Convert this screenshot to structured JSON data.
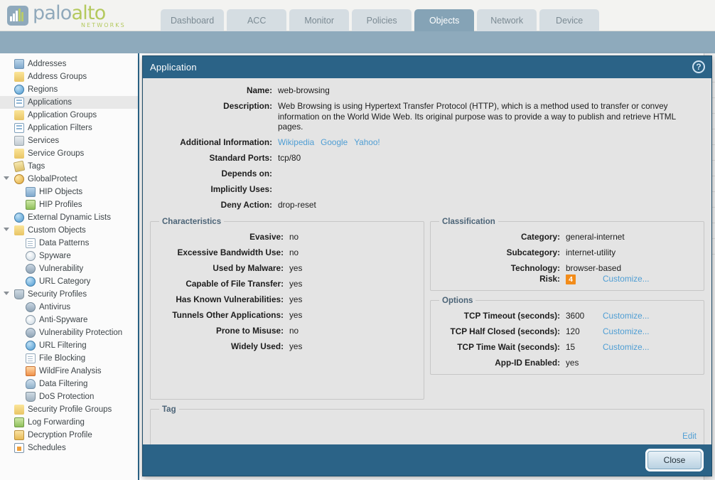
{
  "brand": {
    "name_part1": "palo",
    "name_part2": "alto",
    "tagline": "NETWORKS"
  },
  "nav_tabs": [
    {
      "label": "Dashboard",
      "active": false
    },
    {
      "label": "ACC",
      "active": false
    },
    {
      "label": "Monitor",
      "active": false
    },
    {
      "label": "Policies",
      "active": false
    },
    {
      "label": "Objects",
      "active": true
    },
    {
      "label": "Network",
      "active": false
    },
    {
      "label": "Device",
      "active": false
    }
  ],
  "sidebar": {
    "items": [
      {
        "label": "Addresses",
        "level": 0,
        "icon": "addresses-icon",
        "icon_style": "blue",
        "selected": false,
        "expandable": false
      },
      {
        "label": "Address Groups",
        "level": 0,
        "icon": "address-groups-icon",
        "icon_style": "gold",
        "selected": false,
        "expandable": false
      },
      {
        "label": "Regions",
        "level": 0,
        "icon": "regions-icon",
        "icon_style": "globe",
        "selected": false,
        "expandable": false
      },
      {
        "label": "Applications",
        "level": 0,
        "icon": "applications-icon",
        "icon_style": "grid",
        "selected": true,
        "expandable": false
      },
      {
        "label": "Application Groups",
        "level": 0,
        "icon": "application-groups-icon",
        "icon_style": "gold",
        "selected": false,
        "expandable": false
      },
      {
        "label": "Application Filters",
        "level": 0,
        "icon": "application-filters-icon",
        "icon_style": "grid",
        "selected": false,
        "expandable": false
      },
      {
        "label": "Services",
        "level": 0,
        "icon": "services-icon",
        "icon_style": "tools",
        "selected": false,
        "expandable": false
      },
      {
        "label": "Service Groups",
        "level": 0,
        "icon": "service-groups-icon",
        "icon_style": "gold",
        "selected": false,
        "expandable": false
      },
      {
        "label": "Tags",
        "level": 0,
        "icon": "tags-icon",
        "icon_style": "tag",
        "selected": false,
        "expandable": false
      },
      {
        "label": "GlobalProtect",
        "level": 0,
        "icon": "globalprotect-icon",
        "icon_style": "people",
        "selected": false,
        "expandable": true
      },
      {
        "label": "HIP Objects",
        "level": 1,
        "icon": "hip-objects-icon",
        "icon_style": "blue",
        "selected": false,
        "expandable": false
      },
      {
        "label": "HIP Profiles",
        "level": 1,
        "icon": "hip-profiles-icon",
        "icon_style": "green",
        "selected": false,
        "expandable": false
      },
      {
        "label": "External Dynamic Lists",
        "level": 0,
        "icon": "external-dynamic-lists-icon",
        "icon_style": "globe",
        "selected": false,
        "expandable": false
      },
      {
        "label": "Custom Objects",
        "level": 0,
        "icon": "custom-objects-icon",
        "icon_style": "gold",
        "selected": false,
        "expandable": true
      },
      {
        "label": "Data Patterns",
        "level": 1,
        "icon": "data-patterns-icon",
        "icon_style": "doc",
        "selected": false,
        "expandable": false
      },
      {
        "label": "Spyware",
        "level": 1,
        "icon": "spyware-icon",
        "icon_style": "lens",
        "selected": false,
        "expandable": false
      },
      {
        "label": "Vulnerability",
        "level": 1,
        "icon": "vulnerability-icon",
        "icon_style": "bug",
        "selected": false,
        "expandable": false
      },
      {
        "label": "URL Category",
        "level": 1,
        "icon": "url-category-icon",
        "icon_style": "globe",
        "selected": false,
        "expandable": false
      },
      {
        "label": "Security Profiles",
        "level": 0,
        "icon": "security-profiles-icon",
        "icon_style": "shield",
        "selected": false,
        "expandable": true
      },
      {
        "label": "Antivirus",
        "level": 1,
        "icon": "antivirus-icon",
        "icon_style": "bug",
        "selected": false,
        "expandable": false
      },
      {
        "label": "Anti-Spyware",
        "level": 1,
        "icon": "anti-spyware-icon",
        "icon_style": "lens",
        "selected": false,
        "expandable": false
      },
      {
        "label": "Vulnerability Protection",
        "level": 1,
        "icon": "vulnerability-protection-icon",
        "icon_style": "bug",
        "selected": false,
        "expandable": false
      },
      {
        "label": "URL Filtering",
        "level": 1,
        "icon": "url-filtering-icon",
        "icon_style": "globe",
        "selected": false,
        "expandable": false
      },
      {
        "label": "File Blocking",
        "level": 1,
        "icon": "file-blocking-icon",
        "icon_style": "doc",
        "selected": false,
        "expandable": false
      },
      {
        "label": "WildFire Analysis",
        "level": 1,
        "icon": "wildfire-analysis-icon",
        "icon_style": "fire",
        "selected": false,
        "expandable": false
      },
      {
        "label": "Data Filtering",
        "level": 1,
        "icon": "data-filtering-icon",
        "icon_style": "person",
        "selected": false,
        "expandable": false
      },
      {
        "label": "DoS Protection",
        "level": 1,
        "icon": "dos-protection-icon",
        "icon_style": "shield",
        "selected": false,
        "expandable": false
      },
      {
        "label": "Security Profile Groups",
        "level": 0,
        "icon": "security-profile-groups-icon",
        "icon_style": "gold",
        "selected": false,
        "expandable": false
      },
      {
        "label": "Log Forwarding",
        "level": 0,
        "icon": "log-forwarding-icon",
        "icon_style": "green",
        "selected": false,
        "expandable": false
      },
      {
        "label": "Decryption Profile",
        "level": 0,
        "icon": "decryption-profile-icon",
        "icon_style": "lock",
        "selected": false,
        "expandable": false
      },
      {
        "label": "Schedules",
        "level": 0,
        "icon": "schedules-icon",
        "icon_style": "cal",
        "selected": false,
        "expandable": false
      }
    ]
  },
  "dialog": {
    "title": "Application",
    "help_icon": "help-icon",
    "fields": {
      "name_label": "Name:",
      "name_value": "web-browsing",
      "description_label": "Description:",
      "description_value": "Web Browsing is using Hypertext Transfer Protocol (HTTP), which is a method used to transfer or convey information on the World Wide Web. Its original purpose was to provide a way to publish and retrieve HTML pages.",
      "additional_information_label": "Additional Information:",
      "additional_information_links": [
        "Wikipedia",
        "Google",
        "Yahoo!"
      ],
      "standard_ports_label": "Standard Ports:",
      "standard_ports_value": "tcp/80",
      "depends_on_label": "Depends on:",
      "depends_on_value": "",
      "implicitly_uses_label": "Implicitly Uses:",
      "implicitly_uses_value": "",
      "deny_action_label": "Deny Action:",
      "deny_action_value": "drop-reset"
    },
    "characteristics": {
      "legend": "Characteristics",
      "rows": [
        {
          "label": "Evasive:",
          "value": "no"
        },
        {
          "label": "Excessive Bandwidth Use:",
          "value": "no"
        },
        {
          "label": "Used by Malware:",
          "value": "yes"
        },
        {
          "label": "Capable of File Transfer:",
          "value": "yes"
        },
        {
          "label": "Has Known Vulnerabilities:",
          "value": "yes"
        },
        {
          "label": "Tunnels Other Applications:",
          "value": "yes"
        },
        {
          "label": "Prone to Misuse:",
          "value": "no"
        },
        {
          "label": "Widely Used:",
          "value": "yes"
        }
      ]
    },
    "classification": {
      "legend": "Classification",
      "rows": [
        {
          "label": "Category:",
          "value": "general-internet"
        },
        {
          "label": "Subcategory:",
          "value": "internet-utility"
        },
        {
          "label": "Technology:",
          "value": "browser-based"
        }
      ],
      "risk_label": "Risk:",
      "risk_value": "4",
      "risk_color": "#f28c1a",
      "risk_customize": "Customize..."
    },
    "options": {
      "legend": "Options",
      "rows": [
        {
          "label": "TCP Timeout (seconds):",
          "value": "3600",
          "action": "Customize..."
        },
        {
          "label": "TCP Half Closed (seconds):",
          "value": "120",
          "action": "Customize..."
        },
        {
          "label": "TCP Time Wait (seconds):",
          "value": "15",
          "action": "Customize..."
        },
        {
          "label": "App-ID Enabled:",
          "value": "yes",
          "action": ""
        }
      ]
    },
    "tag": {
      "legend": "Tag",
      "edit_label": "Edit"
    },
    "close_label": "Close"
  }
}
